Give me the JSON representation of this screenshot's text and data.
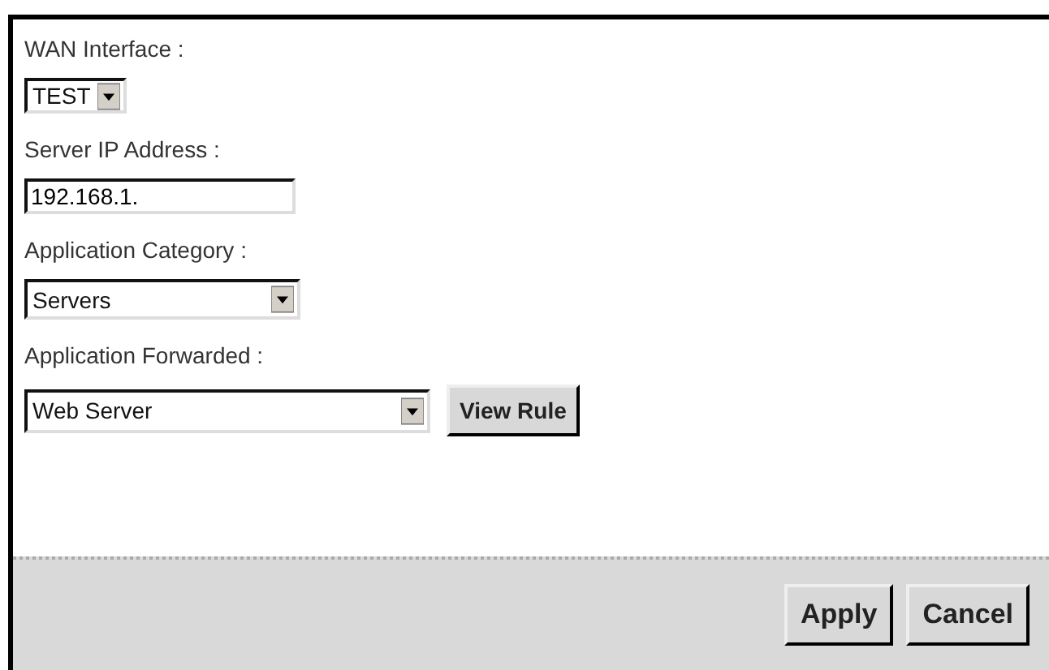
{
  "fields": [
    {
      "label": "WAN Interface :",
      "kind": "select",
      "value": "TEST"
    },
    {
      "label": "Server IP Address :",
      "kind": "text",
      "value": "192.168.1."
    },
    {
      "label": "Application Category :",
      "kind": "select",
      "value": "Servers"
    },
    {
      "label": "Application Forwarded :",
      "kind": "select",
      "value": "Web Server",
      "button": "View Rule"
    }
  ],
  "buttons": [
    "Apply",
    "Cancel"
  ]
}
